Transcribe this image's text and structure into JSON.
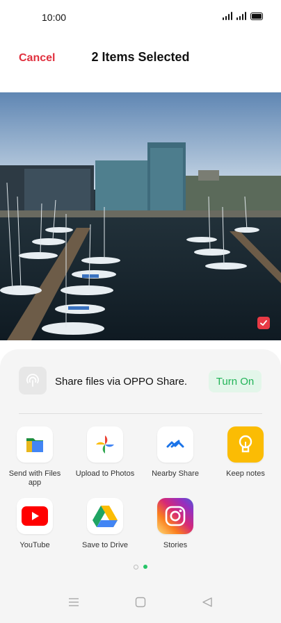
{
  "status_bar": {
    "time": "10:00"
  },
  "header": {
    "cancel_label": "Cancel",
    "title": "2 Items Selected"
  },
  "photo": {
    "selected": true
  },
  "share_sheet": {
    "oppo_share_text": "Share files via OPPO Share.",
    "turn_on_label": "Turn On",
    "apps": [
      {
        "label": "Send with Files app",
        "icon": "files-app-icon"
      },
      {
        "label": "Upload to Photos",
        "icon": "google-photos-icon"
      },
      {
        "label": "Nearby Share",
        "icon": "nearby-share-icon"
      },
      {
        "label": "Keep notes",
        "icon": "keep-notes-icon"
      },
      {
        "label": "YouTube",
        "icon": "youtube-icon"
      },
      {
        "label": "Save to Drive",
        "icon": "google-drive-icon"
      },
      {
        "label": "Stories",
        "icon": "instagram-icon"
      }
    ],
    "page_indicator": {
      "pages": 2,
      "current": 2
    }
  },
  "colors": {
    "accent_red": "#e0303e",
    "accent_green": "#21b357"
  },
  "nav_bar": {
    "buttons": [
      "menu-icon",
      "home-icon",
      "back-icon"
    ]
  }
}
